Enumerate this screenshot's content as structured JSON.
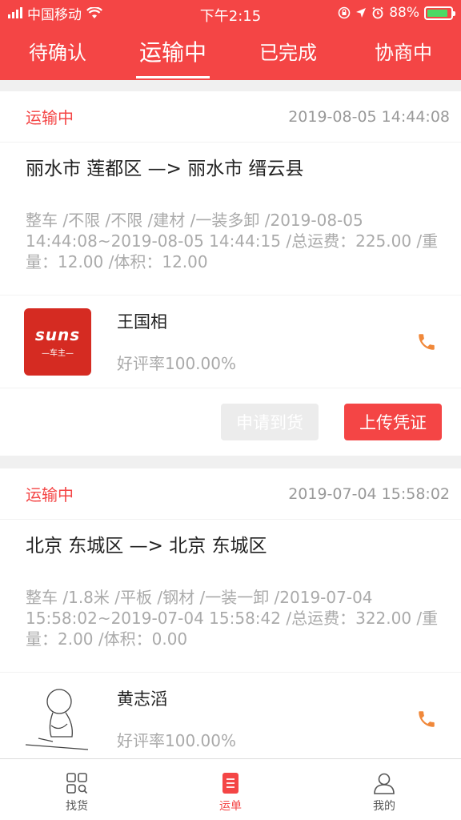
{
  "status_bar": {
    "carrier": "中国移动",
    "time": "下午2:15",
    "battery": "88%",
    "battery_level": 0.88
  },
  "tabs": [
    {
      "label": "待确认",
      "active": false
    },
    {
      "label": "运输中",
      "active": true
    },
    {
      "label": "已完成",
      "active": false
    },
    {
      "label": "协商中",
      "active": false
    }
  ],
  "orders": [
    {
      "status": "运输中",
      "time": "2019-08-05 14:44:08",
      "route": "丽水市 莲都区 —> 丽水市 缙云县",
      "details": "整车 /不限 /不限 /建材 /一装多卸 /2019-08-05 14:44:08~2019-08-05 14:44:15 /总运费：225.00 /重量：12.00 /体积：12.00",
      "driver_name": "王国相",
      "rating": "好评率100.00%",
      "avatar_logo": "suns",
      "avatar_sub": "—车主—",
      "btn_arrival": "申请到货",
      "btn_upload": "上传凭证"
    },
    {
      "status": "运输中",
      "time": "2019-07-04 15:58:02",
      "route": "北京 东城区 —> 北京 东城区",
      "details": "整车 /1.8米 /平板 /钢材 /一装一卸 /2019-07-04 15:58:02~2019-07-04 15:58:42 /总运费：322.00 /重量：2.00 /体积：0.00",
      "driver_name": "黄志滔",
      "rating": "好评率100.00%"
    }
  ],
  "bottom_nav": [
    {
      "label": "找货",
      "icon": "grid-search-icon",
      "active": false
    },
    {
      "label": "运单",
      "icon": "document-icon",
      "active": true
    },
    {
      "label": "我的",
      "icon": "user-icon",
      "active": false
    }
  ],
  "colors": {
    "accent": "#f44545",
    "muted": "#aaaaaa",
    "phone": "#f0883a",
    "suns_red": "#d52b22"
  }
}
